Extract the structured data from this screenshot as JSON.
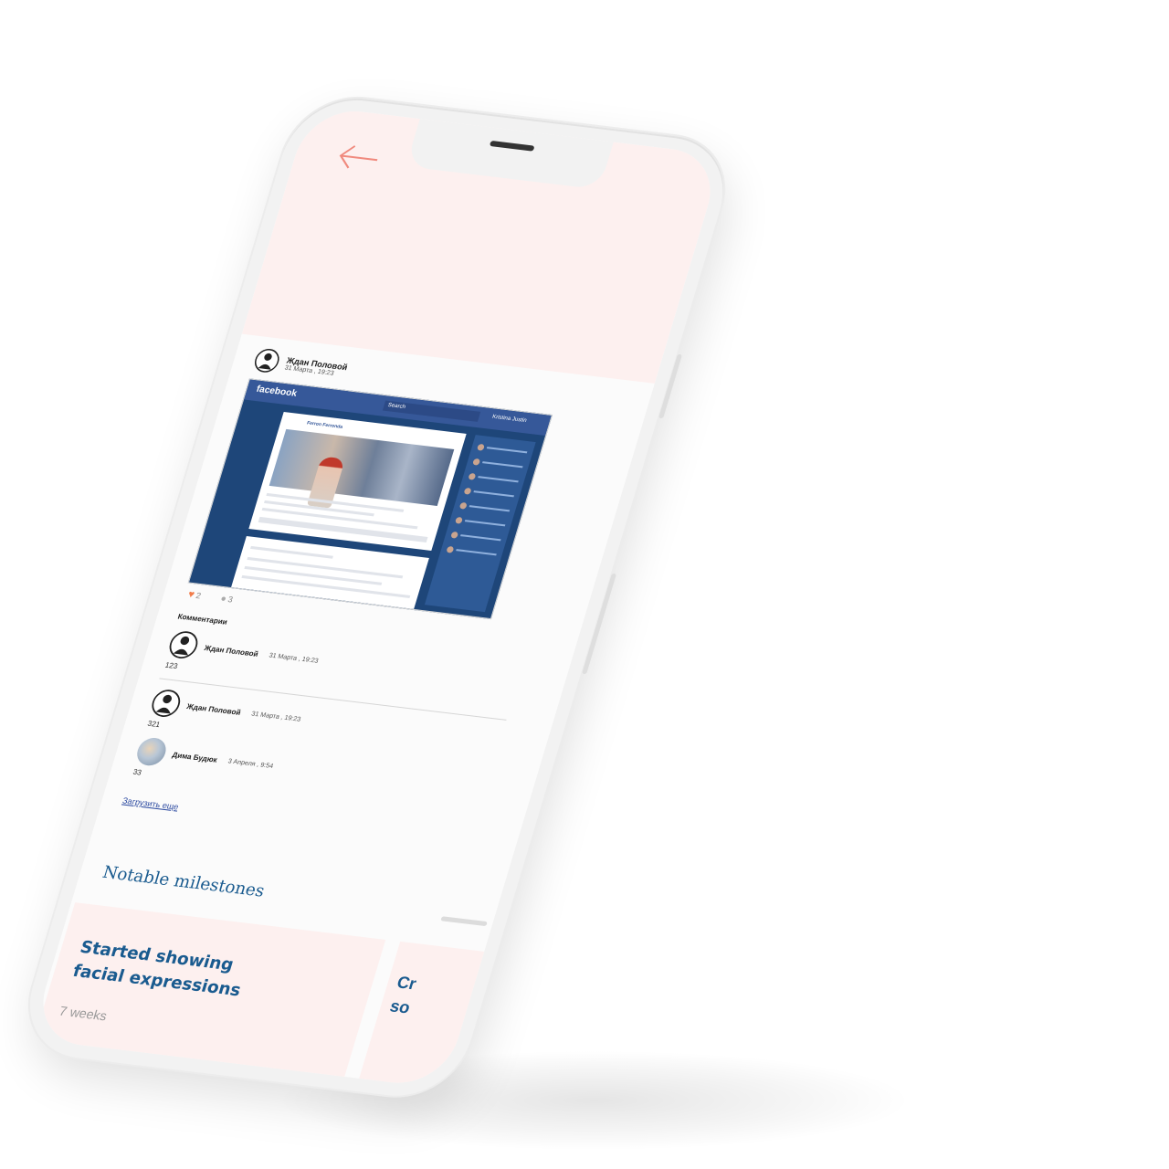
{
  "post": {
    "author": "Ждан Половой",
    "date": "31 Марта , 19:23",
    "embedded_screenshot": {
      "logo": "facebook",
      "search": "Search",
      "user": "Kristina Justin",
      "card_author": "Ferron Ferronda"
    },
    "likes": "2",
    "comments_count": "3"
  },
  "comments": {
    "title": "Комментарии",
    "items": [
      {
        "author": "Ждан Половой",
        "date": "31 Марта , 19:23",
        "text": "123",
        "avatar": "person-icon"
      },
      {
        "author": "Ждан Половой",
        "date": "31 Марта , 19:23",
        "text": "321",
        "avatar": "person-icon"
      },
      {
        "author": "Дима Будюк",
        "date": "3 Апреля , 9:54",
        "text": "33",
        "avatar": "photo"
      }
    ],
    "load_more": "Загрузить еще"
  },
  "milestones": {
    "title": "Notable milestones",
    "cards": [
      {
        "title": "Started showing facial expressions",
        "age": "7 weeks"
      },
      {
        "title": "Cr\nso",
        "age": ""
      }
    ]
  },
  "colors": {
    "accent": "#1a5b8f",
    "hero_bg": "#fdf0ef",
    "back_arrow": "#f08a7e",
    "heart": "#f27c4a",
    "link": "#2c4aa0"
  },
  "icons": {
    "back": "arrow-left-icon",
    "like": "heart-icon",
    "comment": "comment-icon",
    "avatar": "person-icon"
  }
}
